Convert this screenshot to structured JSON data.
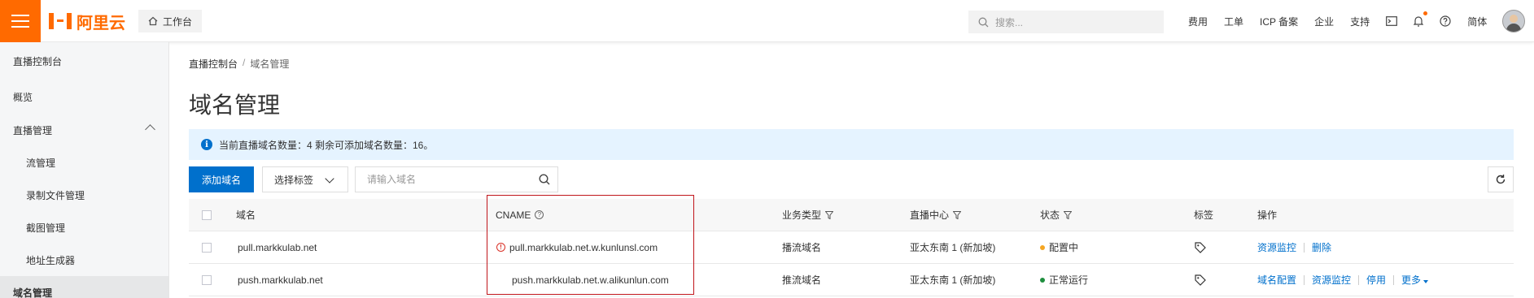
{
  "header": {
    "logo_text": "阿里云",
    "workbench_label": "工作台",
    "search_placeholder": "搜索...",
    "links": [
      "费用",
      "工单",
      "ICP 备案",
      "企业",
      "支持"
    ],
    "lang_label": "简体",
    "brand_color": "#ff6a00"
  },
  "sidebar": {
    "items": [
      {
        "label": "直播控制台"
      },
      {
        "label": "概览"
      },
      {
        "label": "直播管理"
      },
      {
        "label": "流管理"
      },
      {
        "label": "录制文件管理"
      },
      {
        "label": "截图管理"
      },
      {
        "label": "地址生成器"
      },
      {
        "label": "域名管理"
      }
    ]
  },
  "breadcrumb": {
    "root": "直播控制台",
    "sep": "/",
    "current": "域名管理"
  },
  "page_title": "域名管理",
  "notice": {
    "text": "当前直播域名数量：4 剩余可添加域名数量：16。"
  },
  "toolbar": {
    "add_label": "添加域名",
    "tag_select_label": "选择标签",
    "search_placeholder": "请输入域名"
  },
  "table": {
    "headers": {
      "domain": "域名",
      "cname": "CNAME",
      "biz_type": "业务类型",
      "center": "直播中心",
      "status": "状态",
      "tag": "标签",
      "ops": "操作"
    },
    "rows": [
      {
        "domain": "pull.markkulab.net",
        "cname": "pull.markkulab.net.w.kunlunsl.com",
        "cname_warning": true,
        "biz_type": "播流域名",
        "center": "亚太东南 1 (新加坡)",
        "status": "配置中",
        "status_color": "#f5a623",
        "ops": [
          "资源监控",
          "删除"
        ]
      },
      {
        "domain": "push.markkulab.net",
        "cname": "push.markkulab.net.w.alikunlun.com",
        "cname_warning": false,
        "biz_type": "推流域名",
        "center": "亚太东南 1 (新加坡)",
        "status": "正常运行",
        "status_color": "#1e8e3e",
        "ops": [
          "域名配置",
          "资源监控",
          "停用",
          "更多"
        ]
      }
    ]
  }
}
